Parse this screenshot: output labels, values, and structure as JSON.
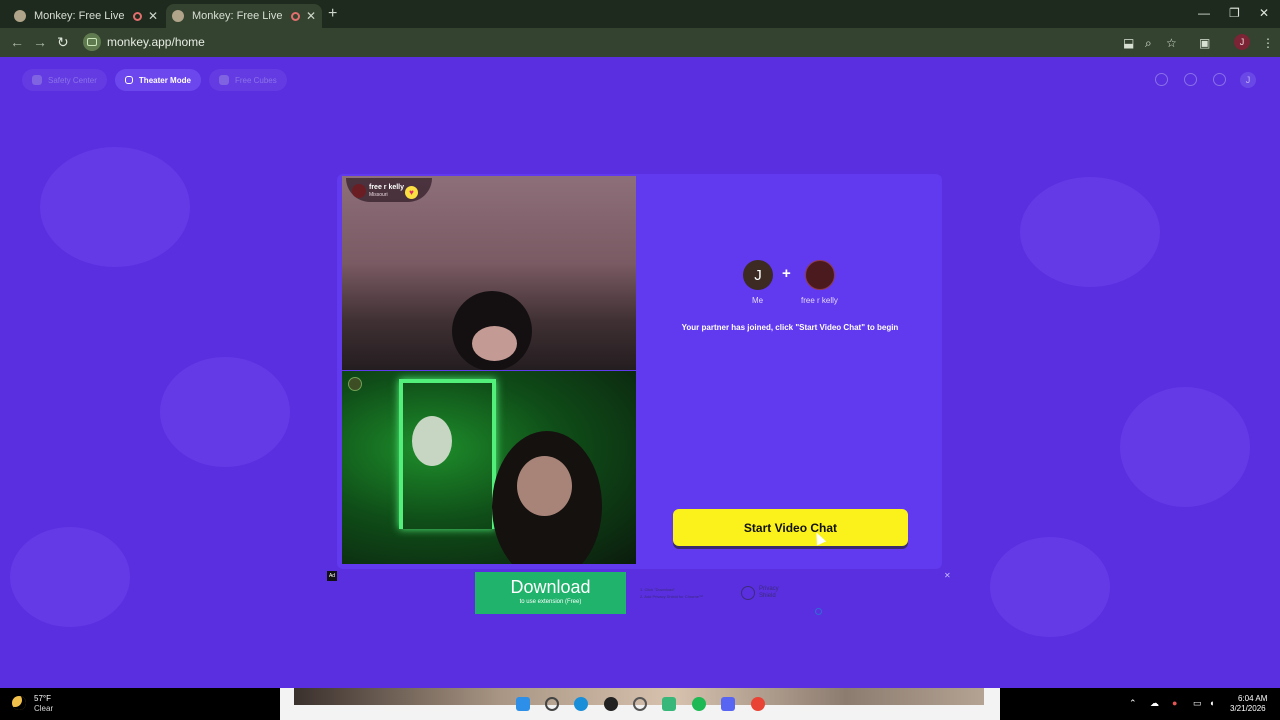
{
  "browser": {
    "tabs": [
      {
        "title": "Monkey: Free Live Video Ch",
        "active": false
      },
      {
        "title": "Monkey: Free Live Video Ch",
        "active": true
      }
    ],
    "new_tab": "+",
    "url": "monkey.app/home",
    "account_initial": "J",
    "window_controls": {
      "minimize": "—",
      "restore": "❐",
      "close": "✕"
    }
  },
  "topnav": {
    "items": [
      {
        "label": "Safety Center",
        "active": false
      },
      {
        "label": "Theater Mode",
        "active": true
      },
      {
        "label": "Free Cubes",
        "active": false
      }
    ],
    "user_initial": "J"
  },
  "videos": {
    "partner": {
      "name": "free r kelly",
      "location": "Missouri",
      "icon": "heart-icon"
    },
    "self": {
      "icon": "camera-badge-icon"
    }
  },
  "match_panel": {
    "me_initial": "J",
    "me_label": "Me",
    "plus": "+",
    "partner_label": "free r kelly",
    "status": "Your partner has joined, click \"Start Video Chat\" to begin",
    "start_button": "Start Video Chat"
  },
  "ad": {
    "badge": "Ad",
    "download_label": "Download",
    "download_sub": "to use extension (Free)",
    "step1": "1. Click \"Download\"",
    "step2": "2. Add Privacy Shield for Chrome™",
    "brand_line1": "Privacy",
    "brand_line2": "Shield",
    "close": "✕"
  },
  "taskbar": {
    "temperature": "57°F",
    "condition": "Clear",
    "time": "6:04 AM",
    "date": "3/21/2026",
    "apps": [
      "windows-icon",
      "search-icon",
      "edge-icon",
      "obs-icon",
      "settings-icon",
      "messages-icon",
      "spotify-icon",
      "discord-icon",
      "chrome-icon"
    ]
  },
  "colors": {
    "page_bg": "#5a2fe0",
    "card_bg": "#6139ee",
    "start_button": "#fbf21b",
    "download_button": "#1fb36b",
    "chrome_bg": "#1e2a1d"
  }
}
